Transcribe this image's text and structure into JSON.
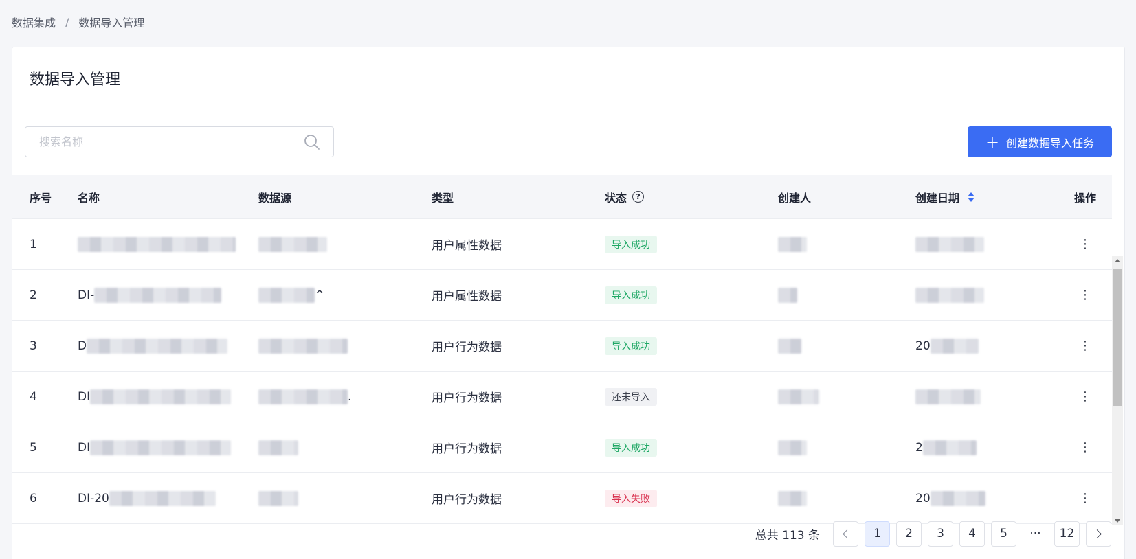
{
  "breadcrumb": {
    "parent": "数据集成",
    "separator": "/",
    "current": "数据导入管理"
  },
  "page": {
    "title": "数据导入管理"
  },
  "toolbar": {
    "search_placeholder": "搜索名称",
    "create_label": "创建数据导入任务"
  },
  "table": {
    "columns": {
      "index": "序号",
      "name": "名称",
      "source": "数据源",
      "type": "类型",
      "status": "状态",
      "creator": "创建人",
      "created_date": "创建日期",
      "actions": "操作"
    },
    "rows": [
      {
        "index": "1",
        "name_prefix": "",
        "source_suffix": "",
        "type": "用户属性数据",
        "status": "导入成功",
        "status_kind": "success",
        "date_prefix": ""
      },
      {
        "index": "2",
        "name_prefix": "DI-",
        "source_suffix": "^",
        "type": "用户属性数据",
        "status": "导入成功",
        "status_kind": "success",
        "date_prefix": ""
      },
      {
        "index": "3",
        "name_prefix": "D",
        "source_suffix": "",
        "type": "用户行为数据",
        "status": "导入成功",
        "status_kind": "success",
        "date_prefix": "20"
      },
      {
        "index": "4",
        "name_prefix": "DI",
        "source_suffix": ".",
        "type": "用户行为数据",
        "status": "还未导入",
        "status_kind": "pending",
        "date_prefix": ""
      },
      {
        "index": "5",
        "name_prefix": "DI",
        "source_suffix": "",
        "type": "用户行为数据",
        "status": "导入成功",
        "status_kind": "success",
        "date_prefix": "2"
      },
      {
        "index": "6",
        "name_prefix": "DI-20",
        "source_suffix": "",
        "type": "用户行为数据",
        "status": "导入失败",
        "status_kind": "failed",
        "date_prefix": "20"
      }
    ]
  },
  "pagination": {
    "total_text": "总共 113 条",
    "pages": [
      "1",
      "2",
      "3",
      "4",
      "5"
    ],
    "active_page": "1",
    "ellipsis": "···",
    "last_page": "12"
  },
  "colors": {
    "primary": "#3a6cf3",
    "success": "#1fa865",
    "failed": "#d9314f"
  }
}
